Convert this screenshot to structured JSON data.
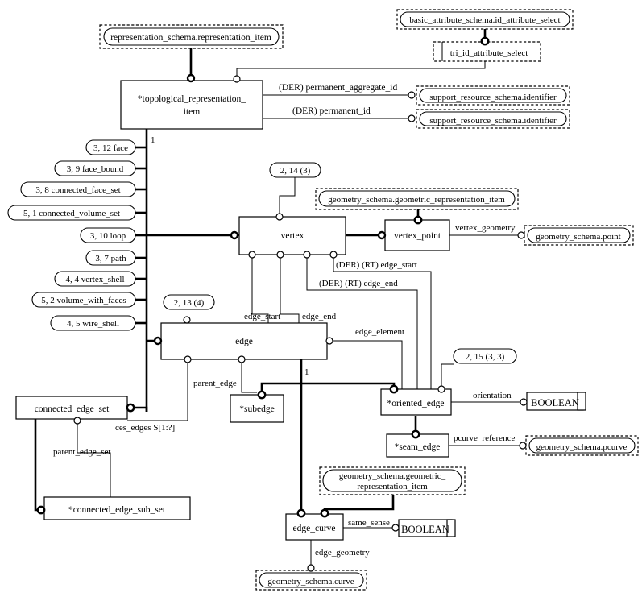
{
  "diagram": {
    "title": "EXPRESS-G topology_schema diagram",
    "entities": {
      "topological_representation_item": "*topological_representation_",
      "topological_representation_item_line2": "item",
      "vertex": "vertex",
      "vertex_point": "vertex_point",
      "edge": "edge",
      "subedge": "*subedge",
      "oriented_edge": "*oriented_edge",
      "seam_edge": "*seam_edge",
      "edge_curve": "edge_curve",
      "connected_edge_set": "connected_edge_set",
      "connected_edge_sub_set": "*connected_edge_sub_set",
      "boolean_orientation": "BOOLEAN",
      "boolean_same_sense": "BOOLEAN"
    },
    "external_refs": {
      "representation_schema_representation_item": "representation_schema.representation_item",
      "basic_attribute_schema_id_attribute_select": "basic_attribute_schema.id_attribute_select",
      "tri_id_attribute_select": "tri_id_attribute_select",
      "support_resource_schema_identifier_1": "support_resource_schema.identifier",
      "support_resource_schema_identifier_2": "support_resource_schema.identifier",
      "geometry_schema_geometric_representation_item_top": "geometry_schema.geometric_representation_item",
      "geometry_schema_point": "geometry_schema.point",
      "geometry_schema_pcurve": "geometry_schema.pcurve",
      "geometry_schema_geometric_representation_item_bottom_l1": "geometry_schema.geometric_",
      "geometry_schema_geometric_representation_item_bottom_l2": "representation_item",
      "geometry_schema_curve": "geometry_schema.curve"
    },
    "page_refs_left": [
      "3, 12 face",
      "3, 9 face_bound",
      "3, 8 connected_face_set",
      "5, 1 connected_volume_set",
      "3, 10 loop",
      "3, 7 path",
      "4, 4 vertex_shell",
      "5, 2 volume_with_faces",
      "4, 5 wire_shell"
    ],
    "page_refs_other": {
      "vertex_ref": "2, 14 (3)",
      "edge_ref": "2, 13 (4)",
      "oriented_edge_ref": "2, 15 (3, 3)"
    },
    "attribute_labels": {
      "permanent_aggregate_id": "(DER) permanent_aggregate_id",
      "permanent_id": "(DER) permanent_id",
      "vertex_geometry": "vertex_geometry",
      "edge_start_der": "(DER) (RT) edge_start",
      "edge_end_der": "(DER) (RT) edge_end",
      "edge_start": "edge_start",
      "edge_end": "edge_end",
      "edge_element": "edge_element",
      "parent_edge": "parent_edge",
      "orientation": "orientation",
      "pcurve_reference": "pcurve_reference",
      "same_sense": "same_sense",
      "edge_geometry": "edge_geometry",
      "ces_edges": "ces_edges S[1:?]",
      "parent_edge_set": "parent_edge_set"
    },
    "cardinalities": {
      "tri_one": "1",
      "edge_one": "1"
    },
    "colors": {
      "line": "#000000",
      "background": "#ffffff",
      "text": "#000000"
    }
  }
}
